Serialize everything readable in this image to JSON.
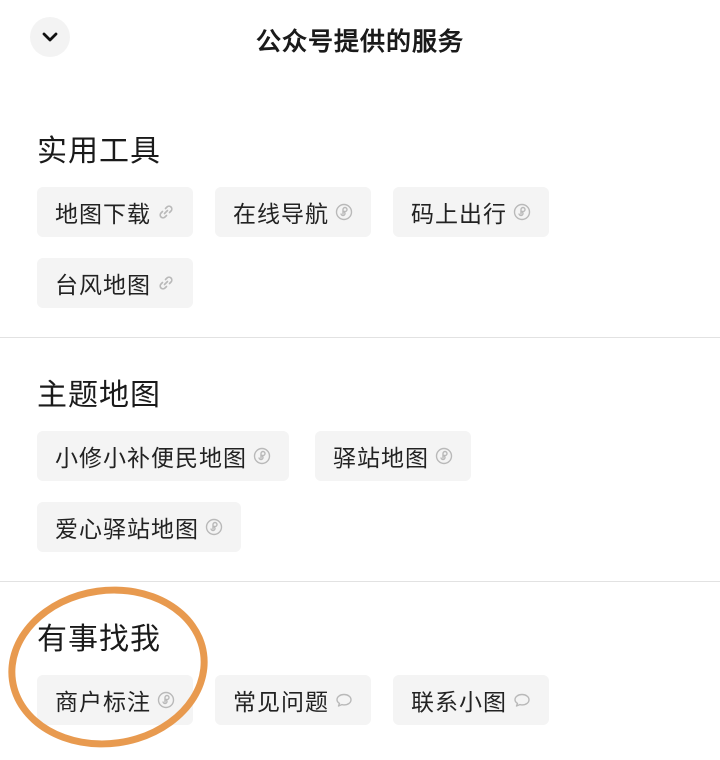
{
  "header": {
    "title": "公众号提供的服务",
    "collapse_icon": "chevron-down-icon"
  },
  "sections": [
    {
      "title": "实用工具",
      "items": [
        {
          "label": "地图下载",
          "icon": "link-icon"
        },
        {
          "label": "在线导航",
          "icon": "mini-program-icon"
        },
        {
          "label": "码上出行",
          "icon": "mini-program-icon"
        },
        {
          "label": "台风地图",
          "icon": "link-icon"
        }
      ]
    },
    {
      "title": "主题地图",
      "items": [
        {
          "label": "小修小补便民地图",
          "icon": "mini-program-icon"
        },
        {
          "label": "驿站地图",
          "icon": "mini-program-icon"
        },
        {
          "label": "爱心驿站地图",
          "icon": "mini-program-icon"
        }
      ]
    },
    {
      "title": "有事找我",
      "items": [
        {
          "label": "商户标注",
          "icon": "mini-program-icon"
        },
        {
          "label": "常见问题",
          "icon": "chat-bubble-icon"
        },
        {
          "label": "联系小图",
          "icon": "chat-bubble-icon"
        }
      ]
    }
  ],
  "annotation": {
    "color": "#e89a4f"
  }
}
